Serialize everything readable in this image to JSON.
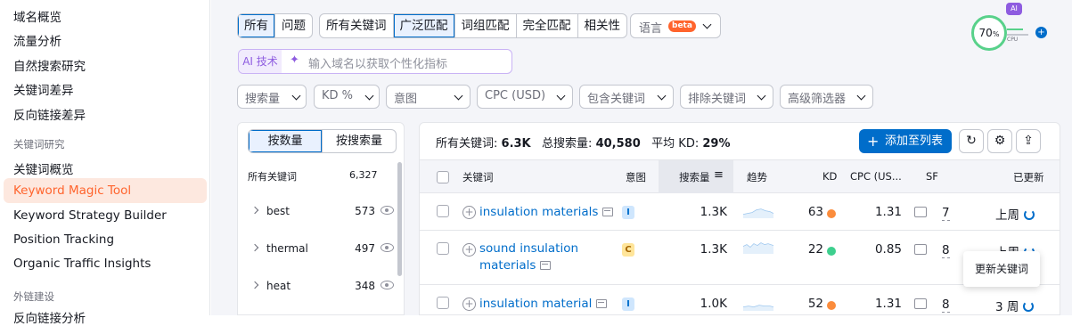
{
  "sidebar": {
    "items_top": [
      "域名概览",
      "流量分析",
      "自然搜索研究",
      "关键词差异",
      "反向链接差异"
    ],
    "section_keyword": "关键词研究",
    "items_keyword": [
      "关键词概览",
      "Keyword Magic Tool",
      "Keyword Strategy Builder",
      "Position Tracking",
      "Organic Traffic Insights"
    ],
    "active_item": "Keyword Magic Tool",
    "section_links": "外链建设",
    "items_links_partial": "反向链接分析"
  },
  "filters": {
    "scope_tabs": [
      "所有",
      "问题"
    ],
    "scope_selected": "所有",
    "match_tabs": [
      "所有关键词",
      "广泛匹配",
      "词组匹配",
      "完全匹配",
      "相关性"
    ],
    "match_selected": "广泛匹配",
    "language_label": "语言",
    "beta_badge": "beta",
    "ai_label": "AI 技术",
    "ai_placeholder": "输入域名以获取个性化指标",
    "dropdowns": [
      "搜索量",
      "KD %",
      "意图",
      "CPC (USD)",
      "包含关键词",
      "排除关键词",
      "高级筛选器"
    ]
  },
  "score_widget": {
    "ai_badge": "AI",
    "value": "70",
    "unit": "%",
    "cpu_label": "CPU"
  },
  "groups_panel": {
    "segment": [
      "按数量",
      "按搜索量"
    ],
    "segment_selected": "按数量",
    "header_label": "所有关键词",
    "header_count": "6,327",
    "groups": [
      {
        "word": "best",
        "count": "573"
      },
      {
        "word": "thermal",
        "count": "497"
      },
      {
        "word": "heat",
        "count": "348"
      }
    ]
  },
  "results": {
    "summary": {
      "all_kw_label": "所有关键词:",
      "all_kw_value": "6.3K",
      "total_vol_label": "总搜索量:",
      "total_vol_value": "40,580",
      "avg_kd_label": "平均 KD:",
      "avg_kd_value": "29%"
    },
    "add_button": "添加至列表",
    "columns": [
      "关键词",
      "意图",
      "搜索量",
      "趋势",
      "KD",
      "CPC (US...",
      "SF",
      "已更新"
    ],
    "sorted_column": "搜索量",
    "rows": [
      {
        "keyword": "insulation materials",
        "intent": "I",
        "intent_color": "#cfe6fd",
        "volume": "1.3K",
        "kd": "63",
        "kd_color": "#fb8c3c",
        "cpc": "1.31",
        "sf": "7",
        "updated": "上周"
      },
      {
        "keyword_line1": "sound insulation",
        "keyword_line2": "materials",
        "intent": "C",
        "intent_color": "#ffe59a",
        "volume": "1.3K",
        "kd": "22",
        "kd_color": "#3ecf8e",
        "cpc": "0.85",
        "sf": "8",
        "updated": "上周"
      },
      {
        "keyword": "insulation material",
        "intent": "I",
        "intent_color": "#cfe6fd",
        "volume": "1.0K",
        "kd": "52",
        "kd_color": "#fb8c3c",
        "cpc": "1.31",
        "sf": "8",
        "updated": "3 周"
      }
    ],
    "tooltip": "更新关键词"
  },
  "colors": {
    "accent": "#006dca",
    "brand_orange": "#ff642d",
    "ai_purple": "#8e5ce0"
  }
}
